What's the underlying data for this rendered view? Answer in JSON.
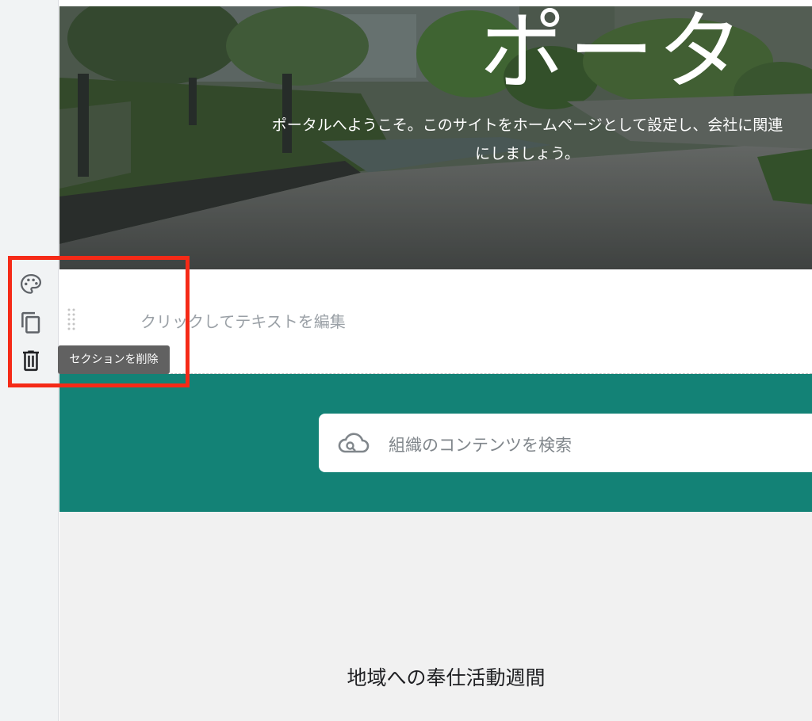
{
  "hero": {
    "title": "ポータ",
    "subtitle_line1": "ポータルへようこそ。このサイトをホームページとして設定し、会社に関連",
    "subtitle_line2": "にしましょう。"
  },
  "text_section": {
    "placeholder": "クリックしてテキストを編集"
  },
  "search": {
    "icon": "cloud-search-icon",
    "placeholder": "組織のコンテンツを検索"
  },
  "lower_section": {
    "title": "地域への奉仕活動週間"
  },
  "section_tools": {
    "palette_icon": "palette-icon",
    "duplicate_icon": "copy-icon",
    "delete_icon": "trash-icon",
    "delete_tooltip": "セクションを削除"
  },
  "colors": {
    "search_band": "#138276",
    "highlight": "#f52a17",
    "tooltip": "#616161",
    "rail": "#f1f3f4"
  }
}
